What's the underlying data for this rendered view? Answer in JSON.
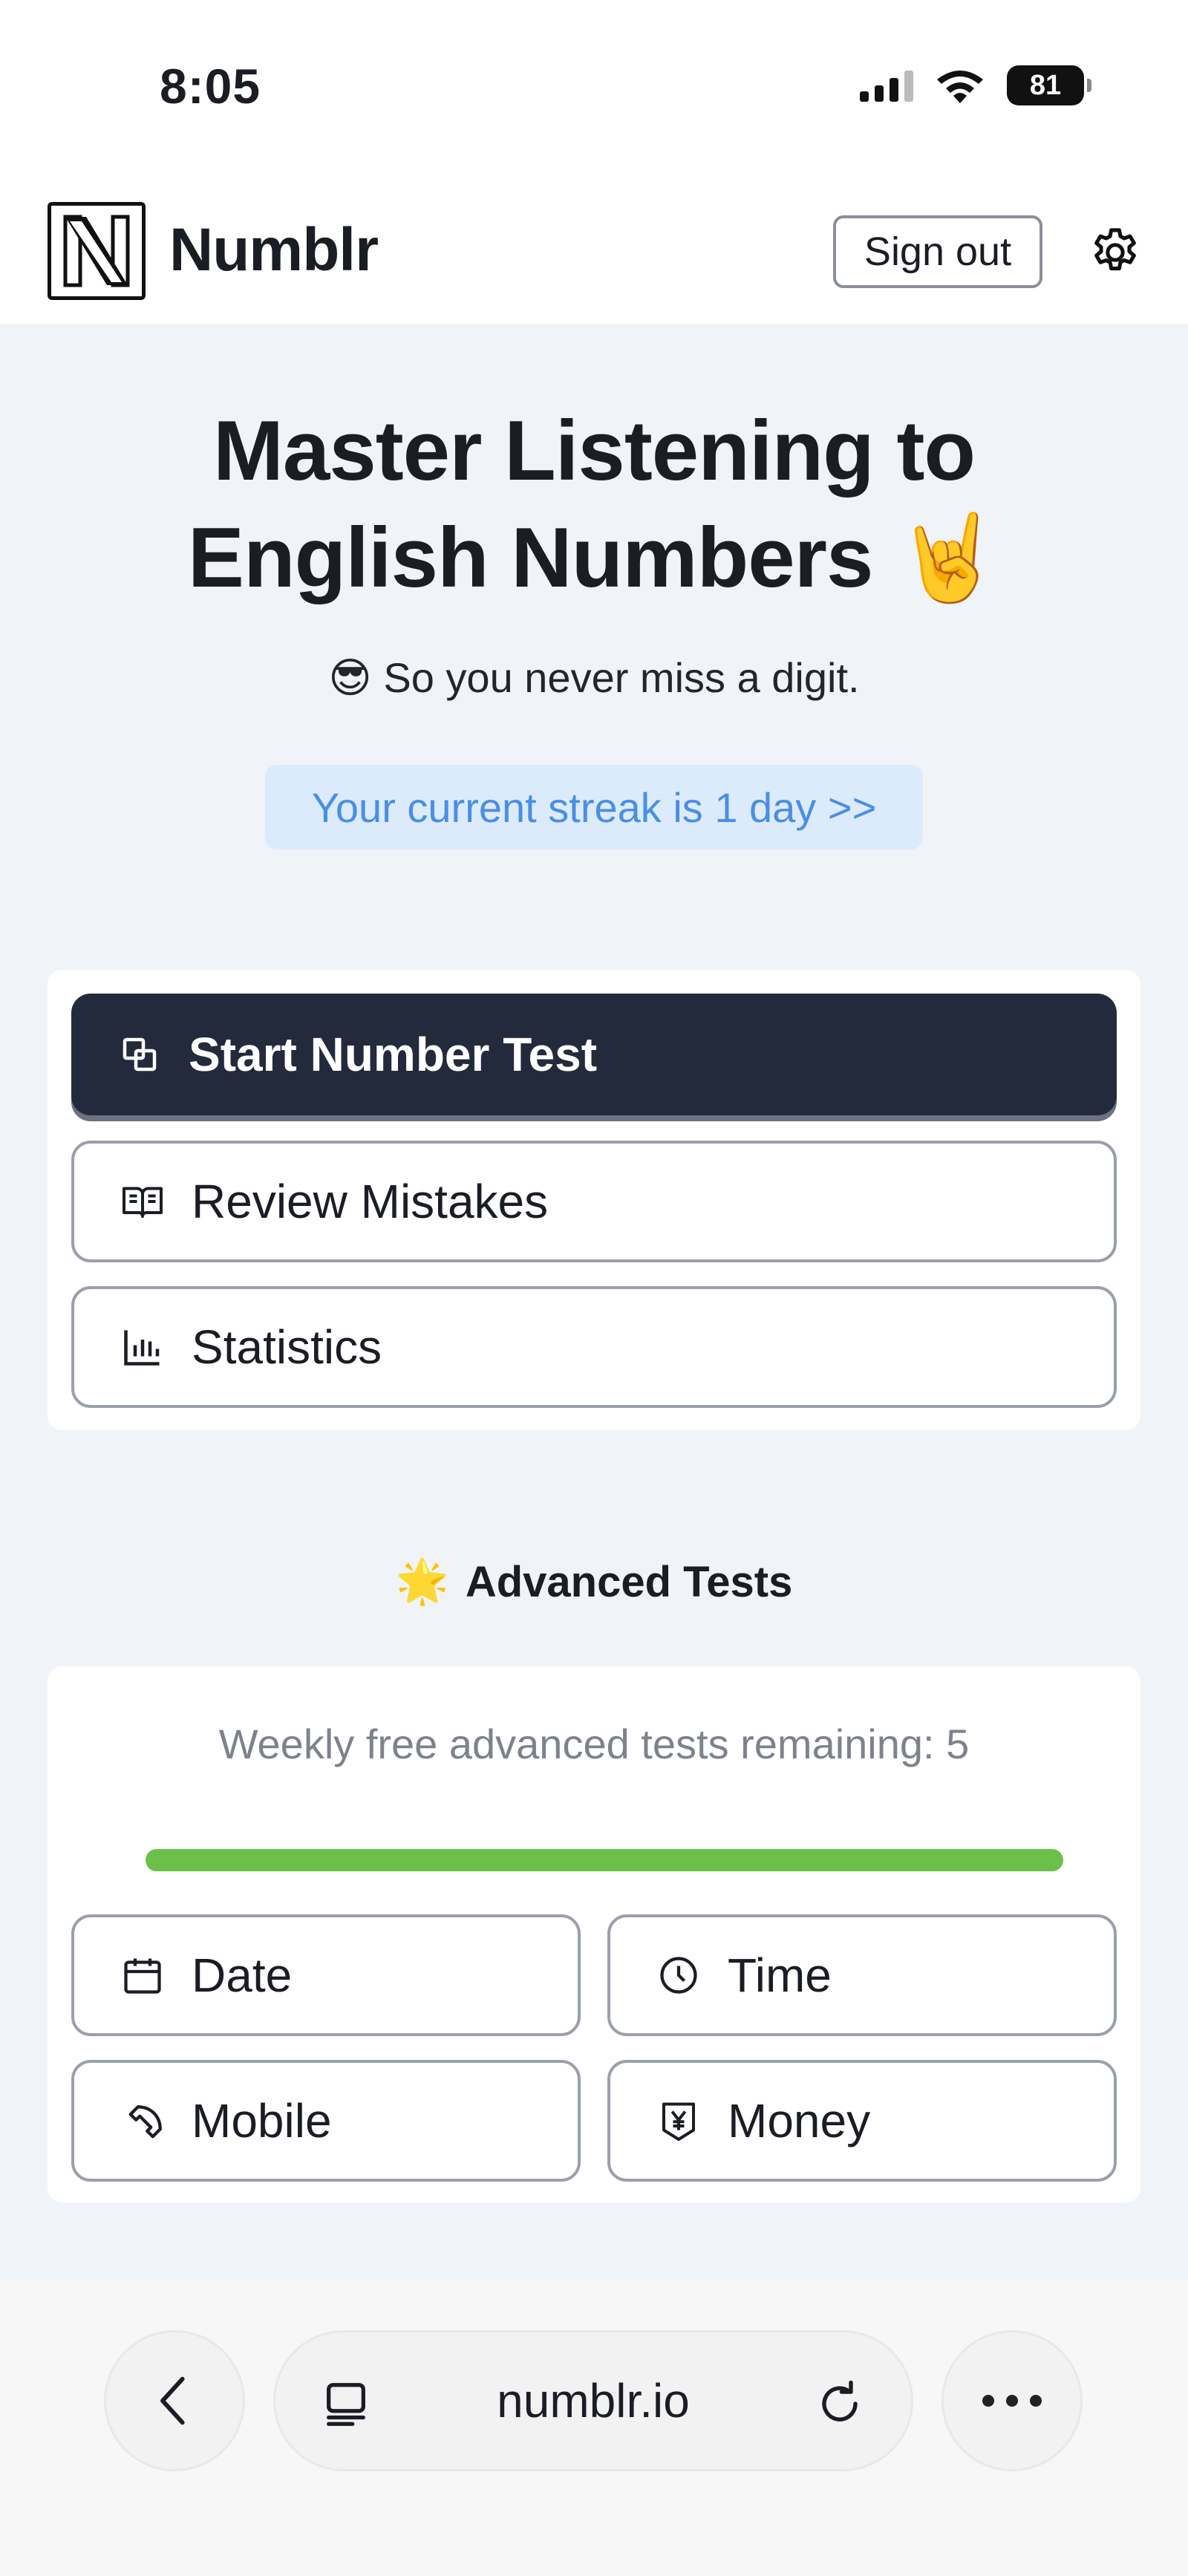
{
  "status": {
    "time": "8:05",
    "battery": "81",
    "icons": [
      "cellular-signal-icon",
      "wifi-icon",
      "battery-icon"
    ]
  },
  "header": {
    "brand": "Numblr",
    "logo_icon": "n-letter-logo",
    "signout_label": "Sign out",
    "settings_icon": "gear-icon"
  },
  "hero": {
    "title_line1": "Master Listening to",
    "title_line2": "English Numbers",
    "title_emoji": "🤘",
    "subtitle_emoji": "😎",
    "subtitle": "So you never miss a digit.",
    "streak": "Your current streak is 1 day >>"
  },
  "main_actions": [
    {
      "label": "Start Number Test",
      "icon": "copy-squares-icon"
    },
    {
      "label": "Review Mistakes",
      "icon": "book-open-icon"
    },
    {
      "label": "Statistics",
      "icon": "bar-chart-icon"
    }
  ],
  "advanced": {
    "heading_emoji": "🌟",
    "heading": "Advanced Tests",
    "remaining_text": "Weekly free advanced tests remaining: 5",
    "remaining_fraction": 1.0,
    "tests": [
      {
        "label": "Date",
        "icon": "calendar-icon"
      },
      {
        "label": "Time",
        "icon": "clock-icon"
      },
      {
        "label": "Mobile",
        "icon": "phone-icon"
      },
      {
        "label": "Money",
        "icon": "yen-shield-icon"
      }
    ]
  },
  "browser": {
    "url": "numblr.io",
    "icons": [
      "back-chevron-icon",
      "tabs-icon",
      "reload-icon",
      "more-icon"
    ]
  },
  "colors": {
    "primary_button": "#232a3c",
    "streak_bg": "#dcebfb",
    "streak_text": "#4a8ee6",
    "progress": "#6cc04a",
    "page_bg": "#f0f3f8"
  }
}
